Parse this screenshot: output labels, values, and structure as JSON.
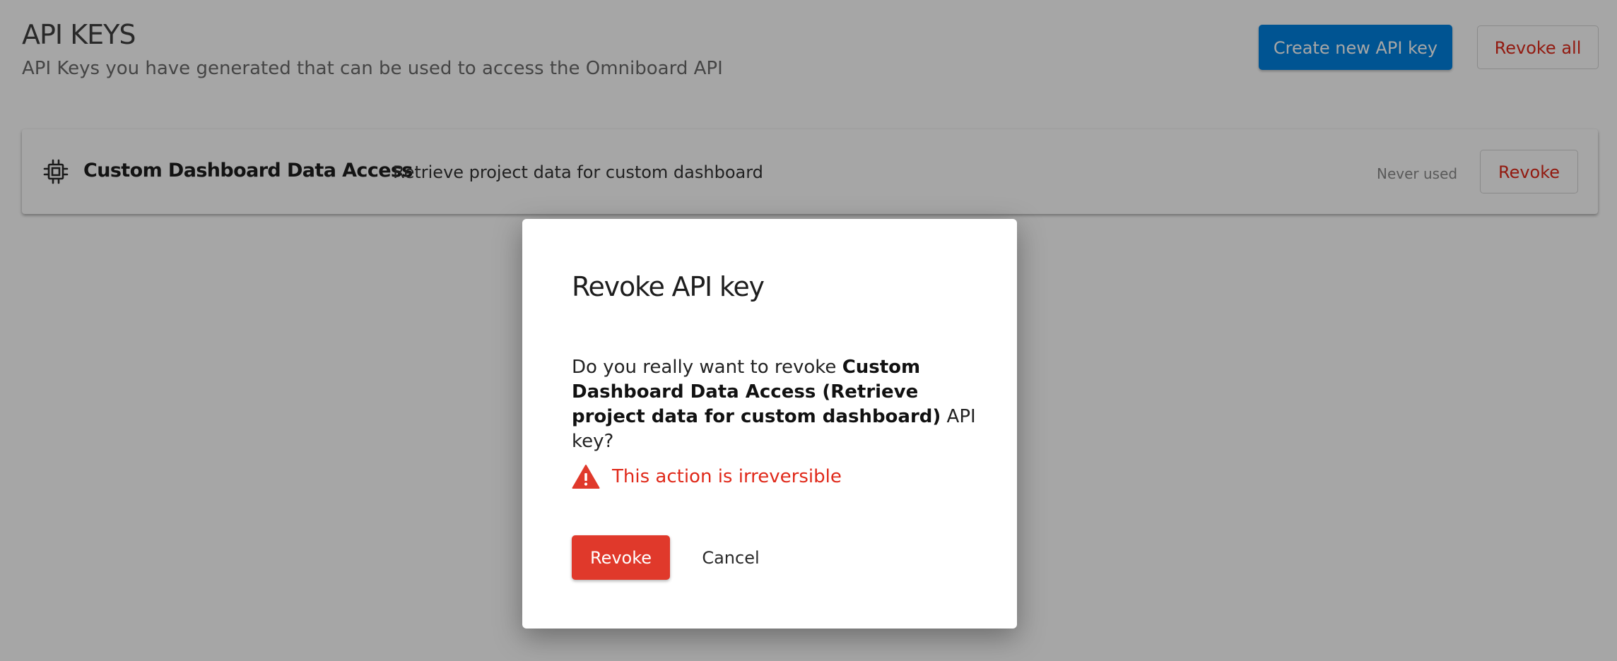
{
  "page": {
    "title": "API KEYS",
    "subtitle": "API Keys you have generated that can be used to access the Omniboard API",
    "create_button": "Create new API key",
    "revoke_all_button": "Revoke all"
  },
  "api_keys": [
    {
      "name": "Custom Dashboard Data Access",
      "description": "Retrieve project data for custom dashboard",
      "usage": "Never used",
      "revoke_button": "Revoke",
      "icon": "chip-icon"
    }
  ],
  "modal": {
    "title": "Revoke API key",
    "body_prefix": "Do you really want to revoke ",
    "body_key_name": "Custom Dashboard Data Access (Retrieve project data for custom dashboard)",
    "body_suffix": " API key?",
    "warning_text": "This action is irreversible",
    "warning_icon": "warning-icon",
    "confirm_button": "Revoke",
    "cancel_button": "Cancel"
  },
  "colors": {
    "primary": "#0082e0",
    "danger": "#e0291a",
    "danger_button": "#e0392b",
    "overlay": "rgba(0,0,0,0.35)"
  }
}
